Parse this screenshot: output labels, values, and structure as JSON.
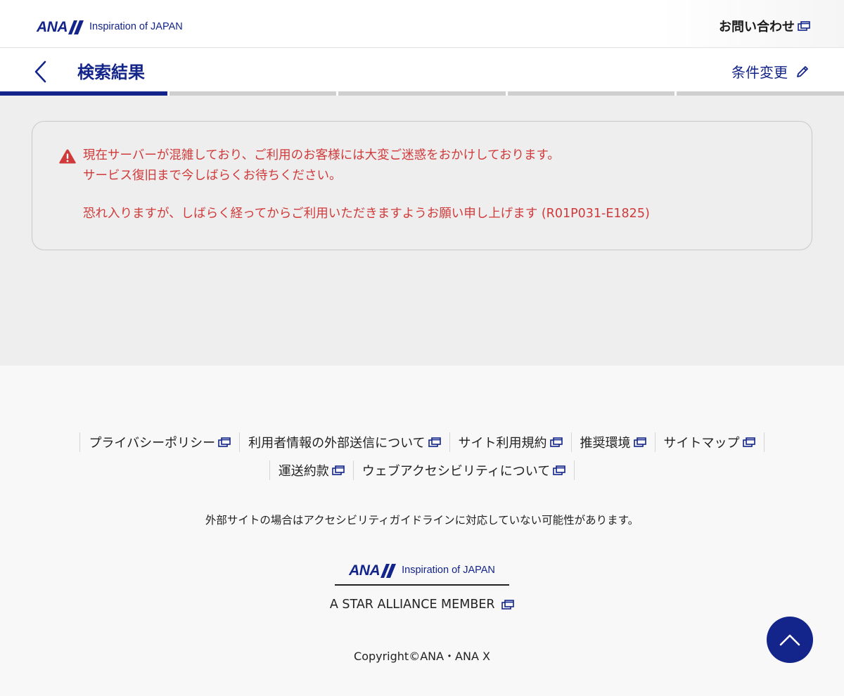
{
  "header": {
    "logo_word": "ANA",
    "logo_tagline": "Inspiration of JAPAN",
    "contact_label": "お問い合わせ"
  },
  "navbar": {
    "title": "検索結果",
    "change_label": "条件変更",
    "progress_steps": 5,
    "active_step": 1
  },
  "alert": {
    "line1": "現在サーバーが混雑しており、ご利用のお客様には大変ご迷惑をおかけしております。",
    "line2": "サービス復旧まで今しばらくお待ちください。",
    "line3": "恐れ入りますが、しばらく経ってからご利用いただきますようお願い申し上げます (R01P031-E1825)",
    "icon": "warning-triangle-icon"
  },
  "footer": {
    "links_row1": [
      "プライバシーポリシー",
      "利用者情報の外部送信について",
      "サイト利用規約",
      "推奨環境",
      "サイトマップ"
    ],
    "links_row2": [
      "運送約款",
      "ウェブアクセシビリティについて"
    ],
    "notice": "外部サイトの場合はアクセシビリティガイドラインに対応していない可能性があります。",
    "logo_word": "ANA",
    "logo_tagline": "Inspiration of JAPAN",
    "alliance": "A STAR ALLIANCE MEMBER",
    "copyright": "Copyright©ANA・ANA X"
  },
  "colors": {
    "brand_navy": "#13248a",
    "alert_red": "#d03a3a",
    "background_gray": "#eeeeee"
  }
}
